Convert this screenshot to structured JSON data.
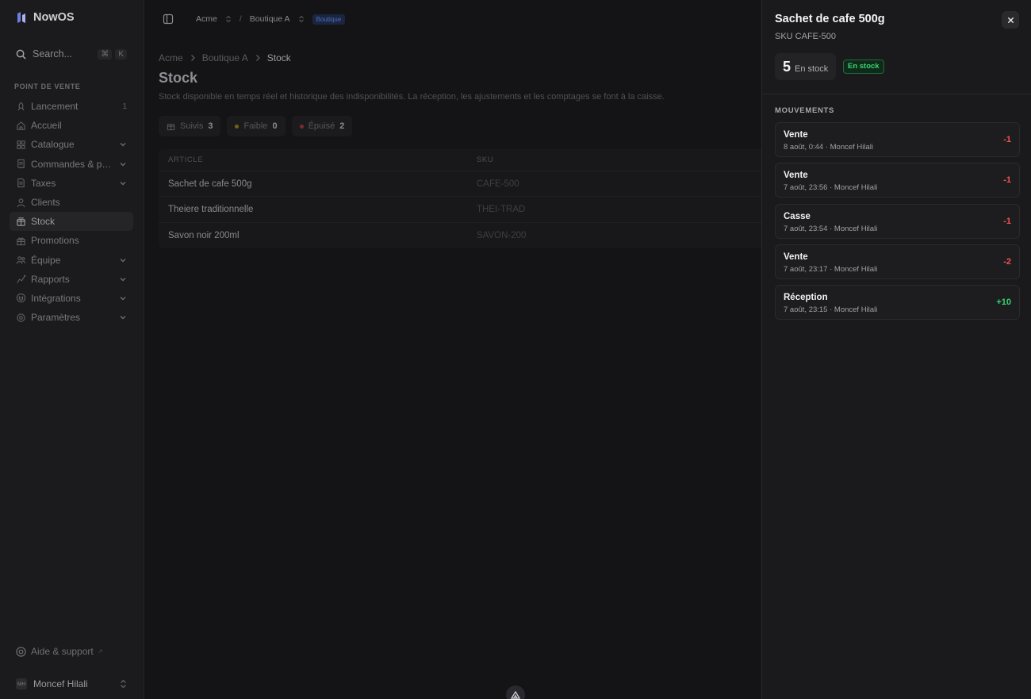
{
  "app": {
    "name": "NowOS"
  },
  "search": {
    "placeholder": "Search...",
    "kbd": [
      "⌘",
      "K"
    ]
  },
  "sidebar": {
    "section": "POINT DE VENTE",
    "items": [
      {
        "label": "Lancement",
        "icon": "rocket-icon",
        "count": "1"
      },
      {
        "label": "Accueil",
        "icon": "home-icon"
      },
      {
        "label": "Catalogue",
        "icon": "grid-icon",
        "chevron": true
      },
      {
        "label": "Commandes & pai...",
        "icon": "receipt-icon",
        "chevron": true
      },
      {
        "label": "Taxes",
        "icon": "document-icon",
        "chevron": true
      },
      {
        "label": "Clients",
        "icon": "user-icon"
      },
      {
        "label": "Stock",
        "icon": "box-icon",
        "active": true
      },
      {
        "label": "Promotions",
        "icon": "gift-icon"
      },
      {
        "label": "Équipe",
        "icon": "team-icon",
        "chevron": true
      },
      {
        "label": "Rapports",
        "icon": "chart-icon",
        "chevron": true
      },
      {
        "label": "Intégrations",
        "icon": "plug-icon",
        "chevron": true
      },
      {
        "label": "Paramètres",
        "icon": "gear-icon",
        "chevron": true
      }
    ],
    "help": "Aide & support",
    "user": {
      "name": "Moncef Hilali",
      "initials": "MH"
    }
  },
  "topbar": {
    "org": "Acme",
    "sep": "/",
    "shop": "Boutique A",
    "badge": "Boutique"
  },
  "breadcrumb": [
    "Acme",
    "Boutique A",
    "Stock"
  ],
  "page": {
    "title": "Stock",
    "subtitle": "Stock disponible en temps réel et historique des indisponibilités. La réception, les ajustements et les comptages se font à la caisse."
  },
  "filters": [
    {
      "label": "Suivis",
      "count": "3"
    },
    {
      "label": "Faible",
      "count": "0",
      "color": "#b5a200"
    },
    {
      "label": "Épuisé",
      "count": "2",
      "color": "#c43b3b"
    }
  ],
  "table": {
    "headers": [
      "ARTICLE",
      "SKU"
    ],
    "rows": [
      {
        "article": "Sachet de cafe 500g",
        "sku": "CAFE-500"
      },
      {
        "article": "Theiere traditionnelle",
        "sku": "THEI-TRAD"
      },
      {
        "article": "Savon noir 200ml",
        "sku": "SAVON-200"
      }
    ]
  },
  "drawer": {
    "title": "Sachet de cafe 500g",
    "sku": "SKU CAFE-500",
    "qty": "5",
    "qty_label": "En stock",
    "status": "En stock",
    "section": "MOUVEMENTS",
    "moves": [
      {
        "type": "Vente",
        "meta": "8 août, 0:44 · Moncef Hilali",
        "delta": "-1",
        "sign": "neg"
      },
      {
        "type": "Vente",
        "meta": "7 août, 23:56 · Moncef Hilali",
        "delta": "-1",
        "sign": "neg"
      },
      {
        "type": "Casse",
        "meta": "7 août, 23:54 · Moncef Hilali",
        "delta": "-1",
        "sign": "neg"
      },
      {
        "type": "Vente",
        "meta": "7 août, 23:17 · Moncef Hilali",
        "delta": "-2",
        "sign": "neg"
      },
      {
        "type": "Réception",
        "meta": "7 août, 23:15 · Moncef Hilali",
        "delta": "+10",
        "sign": "pos"
      }
    ]
  }
}
